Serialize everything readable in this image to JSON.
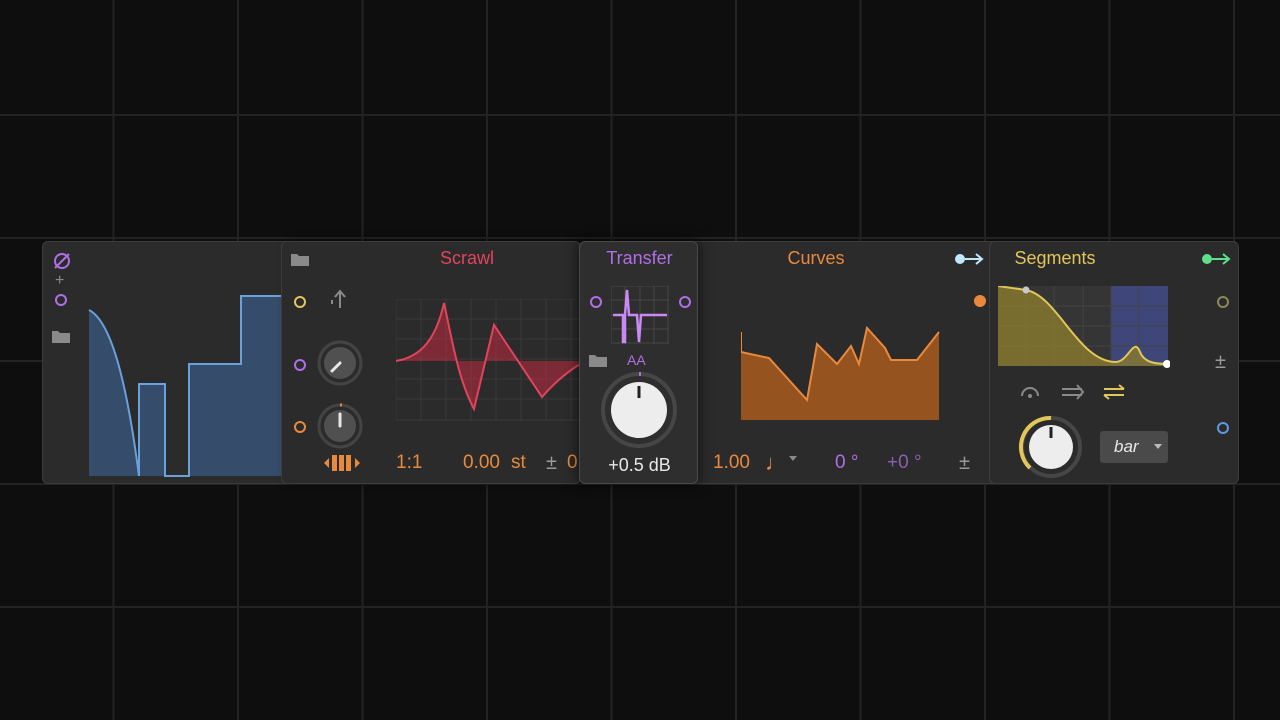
{
  "devices": {
    "first": {
      "curve": "blue step/sine waveform"
    },
    "scrawl": {
      "title": "Scrawl",
      "ratio": "1:1",
      "offset_value": "0.00",
      "offset_unit": "st",
      "plusminus": "±",
      "trailing": "0",
      "color": "#e0455c"
    },
    "transfer": {
      "title": "Transfer",
      "aa_label": "AA",
      "gain": "+0.5 dB",
      "color": "#b06fe6"
    },
    "curves": {
      "title": "Curves",
      "rate": "1.00",
      "note_symbol": "♩",
      "phase": "0 °",
      "phase_offset": "+0 °",
      "plusminus": "±",
      "color": "#e8893d"
    },
    "segments": {
      "title": "Segments",
      "mode": "bar",
      "plusminus": "±",
      "color": "#e2c65a"
    }
  },
  "colors": {
    "blue": "#5b8fcb",
    "purple": "#b06fe6",
    "yellow": "#e2c65a",
    "orange": "#e8893d",
    "red": "#e0455c",
    "green": "#5ee08a",
    "cyan": "#bfe8ff"
  }
}
